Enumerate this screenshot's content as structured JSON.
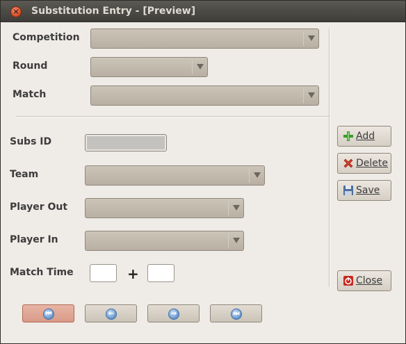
{
  "window": {
    "title": "Substitution Entry - [Preview]",
    "close_icon": "×"
  },
  "filters": {
    "competition_label": "Competition",
    "round_label": "Round",
    "match_label": "Match"
  },
  "form": {
    "subs_id_label": "Subs ID",
    "team_label": "Team",
    "player_out_label": "Player Out",
    "player_in_label": "Player In",
    "match_time_label": "Match Time",
    "plus_sign": "+"
  },
  "actions": {
    "add_label": "Add",
    "delete_label": "Delete",
    "save_label": "Save",
    "close_label": "Close"
  },
  "navigation": {
    "first_glyph": "⏮",
    "prev_glyph": "←",
    "next_glyph": "→",
    "last_glyph": "⏭"
  }
}
